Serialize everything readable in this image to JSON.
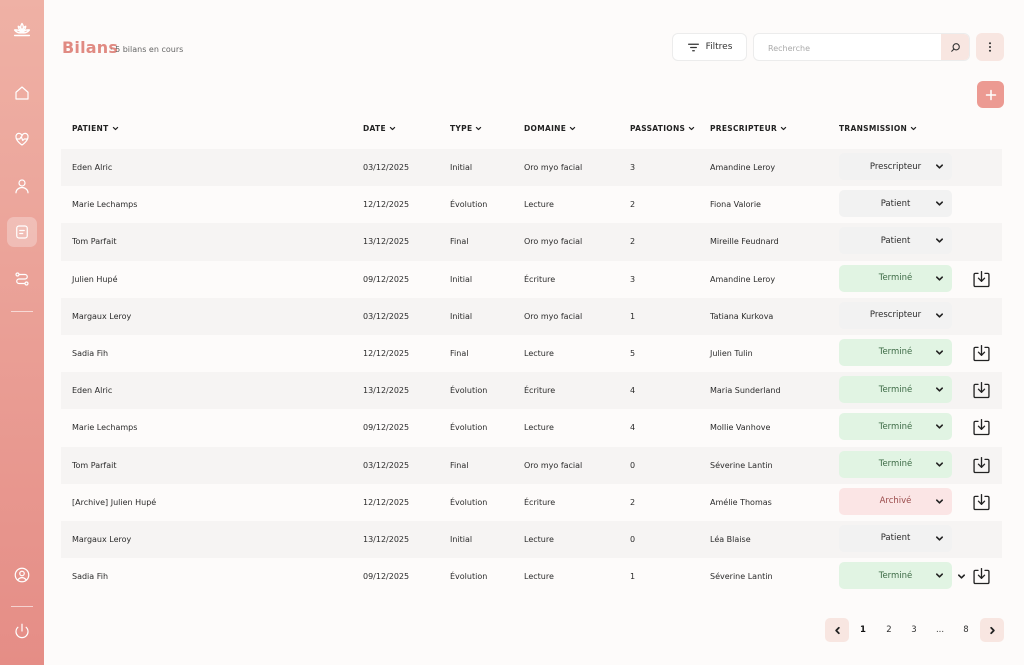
{
  "header": {
    "title": "Bilans",
    "subtitle": "· 5 bilans en cours"
  },
  "toolbar": {
    "filter_label": "Filtres",
    "search_placeholder": "Recherche"
  },
  "sidebar": {
    "items": [
      {
        "icon": "lotus-logo-icon"
      },
      {
        "icon": "home-icon"
      },
      {
        "icon": "heart-pulse-icon"
      },
      {
        "icon": "user-icon"
      },
      {
        "icon": "document-icon",
        "active": true
      },
      {
        "icon": "route-icon"
      },
      {
        "icon": "user-circle-icon"
      },
      {
        "icon": "power-icon"
      }
    ]
  },
  "table": {
    "headers": {
      "patient": "PATIENT",
      "date": "DATE",
      "type": "TYPE",
      "domaine": "DOMAINE",
      "passations": "PASSATIONS",
      "prescripteur": "PRESCRIPTEUR",
      "transmission": "TRANSMISSION"
    },
    "rows": [
      {
        "patient": "Eden Alric",
        "date": "03/12/2025",
        "type": "Initial",
        "domaine": "Oro myo facial",
        "passations": "3",
        "prescripteur": "Amandine Leroy",
        "transmission": "Prescripteur",
        "status": "neutral",
        "download": false
      },
      {
        "patient": "Marie Lechamps",
        "date": "12/12/2025",
        "type": "Évolution",
        "domaine": "Lecture",
        "passations": "2",
        "prescripteur": "Fiona Valorie",
        "transmission": "Patient",
        "status": "neutral",
        "download": false
      },
      {
        "patient": "Tom Parfait",
        "date": "13/12/2025",
        "type": "Final",
        "domaine": "Oro myo facial",
        "passations": "2",
        "prescripteur": "Mireille Feudnard",
        "transmission": "Patient",
        "status": "neutral",
        "download": false
      },
      {
        "patient": "Julien Hupé",
        "date": "09/12/2025",
        "type": "Initial",
        "domaine": "Écriture",
        "passations": "3",
        "prescripteur": "Amandine Leroy",
        "transmission": "Terminé",
        "status": "done",
        "download": true
      },
      {
        "patient": "Margaux Leroy",
        "date": "03/12/2025",
        "type": "Initial",
        "domaine": "Oro myo facial",
        "passations": "1",
        "prescripteur": "Tatiana Kurkova",
        "transmission": "Prescripteur",
        "status": "neutral",
        "download": false
      },
      {
        "patient": "Sadia Fih",
        "date": "12/12/2025",
        "type": "Final",
        "domaine": "Lecture",
        "passations": "5",
        "prescripteur": "Julien Tulin",
        "transmission": "Terminé",
        "status": "done",
        "download": true
      },
      {
        "patient": "Eden Alric",
        "date": "13/12/2025",
        "type": "Évolution",
        "domaine": "Écriture",
        "passations": "4",
        "prescripteur": "Maria Sunderland",
        "transmission": "Terminé",
        "status": "done",
        "download": true
      },
      {
        "patient": "Marie Lechamps",
        "date": "09/12/2025",
        "type": "Évolution",
        "domaine": "Lecture",
        "passations": "4",
        "prescripteur": "Mollie Vanhove",
        "transmission": "Terminé",
        "status": "done",
        "download": true
      },
      {
        "patient": "Tom Parfait",
        "date": "03/12/2025",
        "type": "Final",
        "domaine": "Oro myo facial",
        "passations": "0",
        "prescripteur": "Séverine Lantin",
        "transmission": "Terminé",
        "status": "done",
        "download": true
      },
      {
        "patient": "[Archive] Julien Hupé",
        "date": "12/12/2025",
        "type": "Évolution",
        "domaine": "Écriture",
        "passations": "2",
        "prescripteur": "Amélie Thomas",
        "transmission": "Archivé",
        "status": "archived",
        "download": true
      },
      {
        "patient": "Margaux Leroy",
        "date": "13/12/2025",
        "type": "Initial",
        "domaine": "Lecture",
        "passations": "0",
        "prescripteur": "Léa Blaise",
        "transmission": "Patient",
        "status": "neutral",
        "download": false
      },
      {
        "patient": "Sadia Fih",
        "date": "09/12/2025",
        "type": "Évolution",
        "domaine": "Lecture",
        "passations": "1",
        "prescripteur": "Séverine Lantin",
        "transmission": "Terminé",
        "status": "done",
        "download": true,
        "extra_chevron": true
      }
    ]
  },
  "pagination": {
    "pages": [
      "1",
      "2",
      "3",
      "...",
      "8"
    ],
    "current": "1"
  },
  "colors": {
    "accent": "#e08a82",
    "status_neutral": "#f2f2f2",
    "status_done": "#e1f4e3",
    "status_archived": "#fbe5e5",
    "text_done": "#3d6b46",
    "text_archived": "#9a4a4a"
  }
}
